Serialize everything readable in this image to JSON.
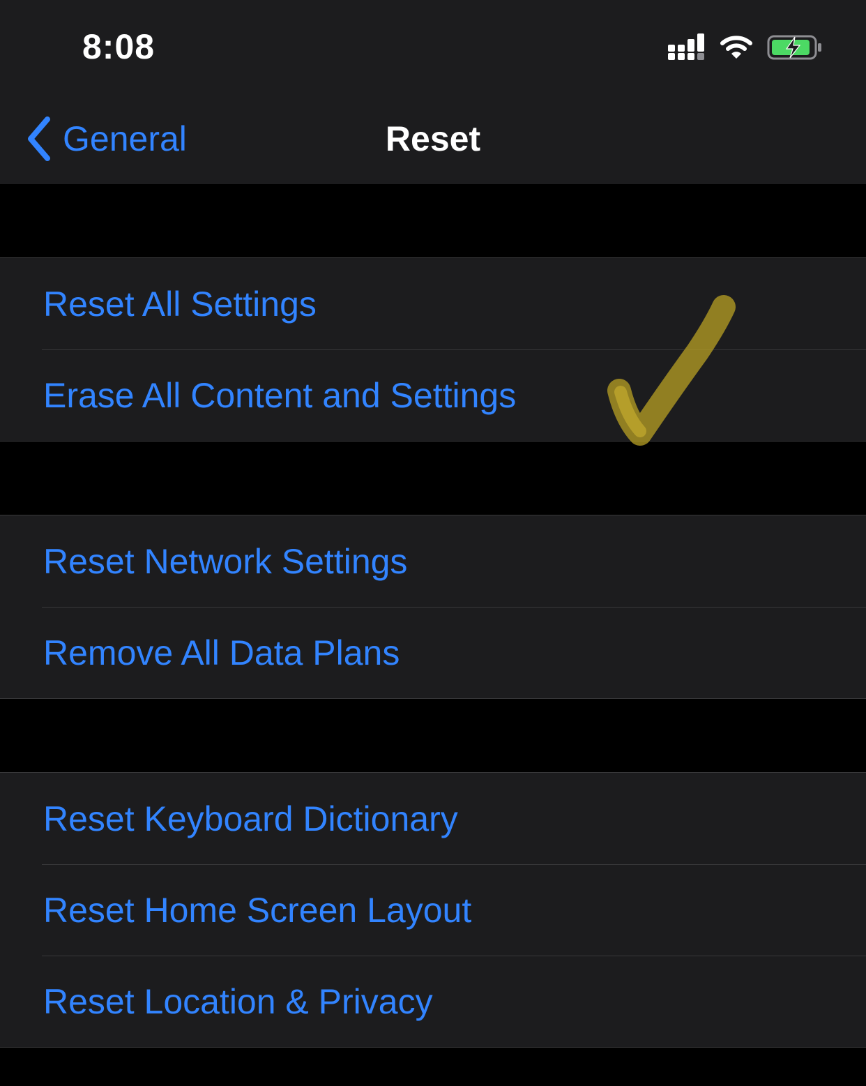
{
  "status_bar": {
    "time": "8:08",
    "icons": [
      "cellular-signal-icon",
      "wifi-icon",
      "battery-charging-icon"
    ]
  },
  "nav": {
    "back_label": "General",
    "title": "Reset"
  },
  "groups": [
    {
      "items": [
        {
          "label": "Reset All Settings"
        },
        {
          "label": "Erase All Content and Settings"
        }
      ]
    },
    {
      "items": [
        {
          "label": "Reset Network Settings"
        },
        {
          "label": "Remove All Data Plans"
        }
      ]
    },
    {
      "items": [
        {
          "label": "Reset Keyboard Dictionary"
        },
        {
          "label": "Reset Home Screen Layout"
        },
        {
          "label": "Reset Location & Privacy"
        }
      ]
    }
  ],
  "annotation": {
    "icon": "hand-drawn-checkmark",
    "color": "#b8a024"
  },
  "colors": {
    "accent": "#3284ff",
    "background": "#000000",
    "cell": "#1c1c1e",
    "separator": "#38383a",
    "battery_fill": "#4cd964"
  }
}
